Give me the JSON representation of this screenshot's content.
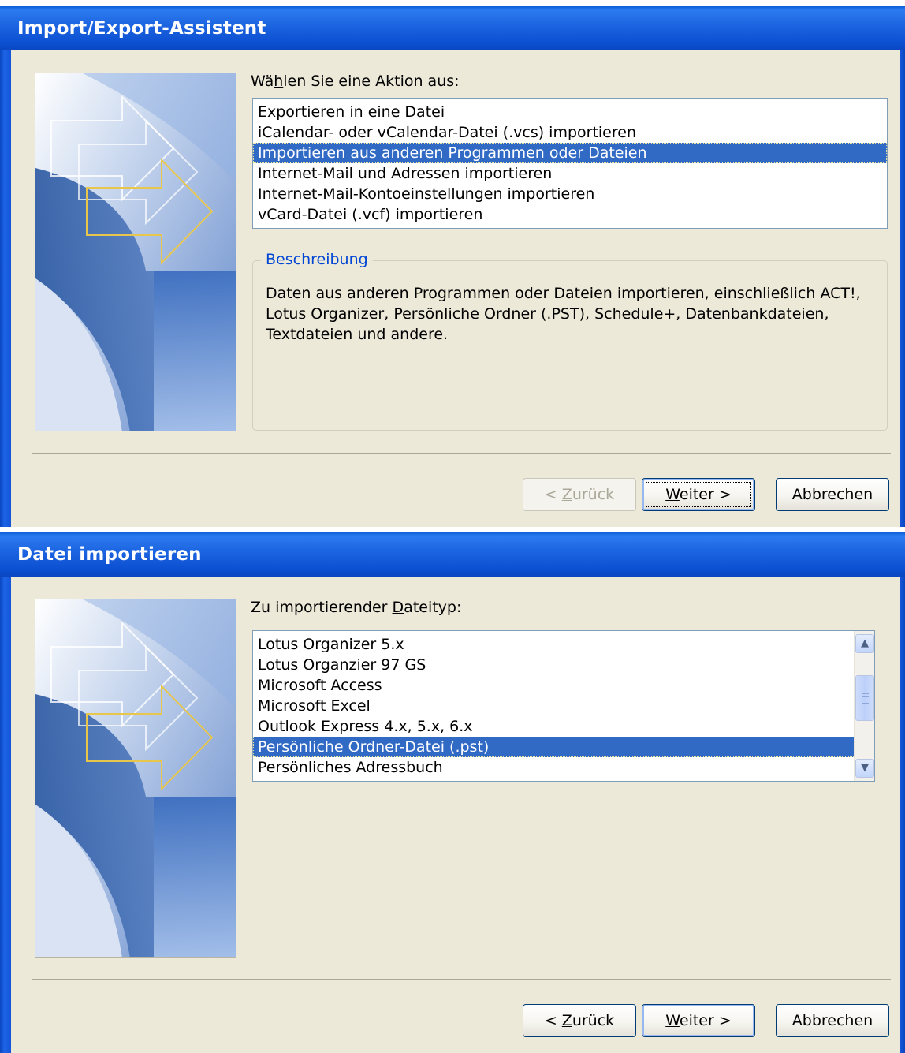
{
  "dialog1": {
    "title": "Import/Export-Assistent",
    "prompt_pre": "Wä",
    "prompt_mnemonic": "h",
    "prompt_post": "len Sie eine Aktion aus:",
    "actions": [
      "Exportieren in eine Datei",
      "iCalendar- oder vCalendar-Datei (.vcs) importieren",
      "Importieren aus anderen Programmen oder Dateien",
      "Internet-Mail und Adressen importieren",
      "Internet-Mail-Kontoeinstellungen importieren",
      "vCard-Datei (.vcf) importieren"
    ],
    "selected_index": 2,
    "description_label": "Beschreibung",
    "description_text": "Daten aus anderen Programmen oder Dateien importieren, einschließlich ACT!, Lotus Organizer, Persönliche Ordner (.PST), Schedule+, Datenbankdateien, Textdateien und andere.",
    "buttons": {
      "back_pre": "< ",
      "back_mnemonic": "Z",
      "back_post": "urück",
      "back_enabled": false,
      "next_mnemonic": "W",
      "next_post": "eiter >",
      "cancel": "Abbrechen"
    }
  },
  "dialog2": {
    "title": "Datei importieren",
    "prompt_pre": "Zu importierender ",
    "prompt_mnemonic": "D",
    "prompt_post": "ateityp:",
    "file_types": [
      "Lotus Organizer 5.x",
      "Lotus Organzier 97 GS",
      "Microsoft Access",
      "Microsoft Excel",
      "Outlook Express 4.x, 5.x, 6.x",
      "Persönliche Ordner-Datei (.pst)",
      "Persönliches Adressbuch"
    ],
    "selected_index": 5,
    "buttons": {
      "back_pre": "< ",
      "back_mnemonic": "Z",
      "back_post": "urück",
      "back_enabled": true,
      "next_mnemonic": "W",
      "next_post": "eiter >",
      "cancel": "Abbrechen"
    }
  },
  "colors": {
    "titlebar": "#0a54d8",
    "selection": "#316ac5",
    "dialog_bg": "#ece9d8",
    "group_label": "#0046d5"
  },
  "icons": [
    "wizard-arrow-graphic-icon",
    "scroll-up-icon",
    "scroll-down-icon"
  ]
}
